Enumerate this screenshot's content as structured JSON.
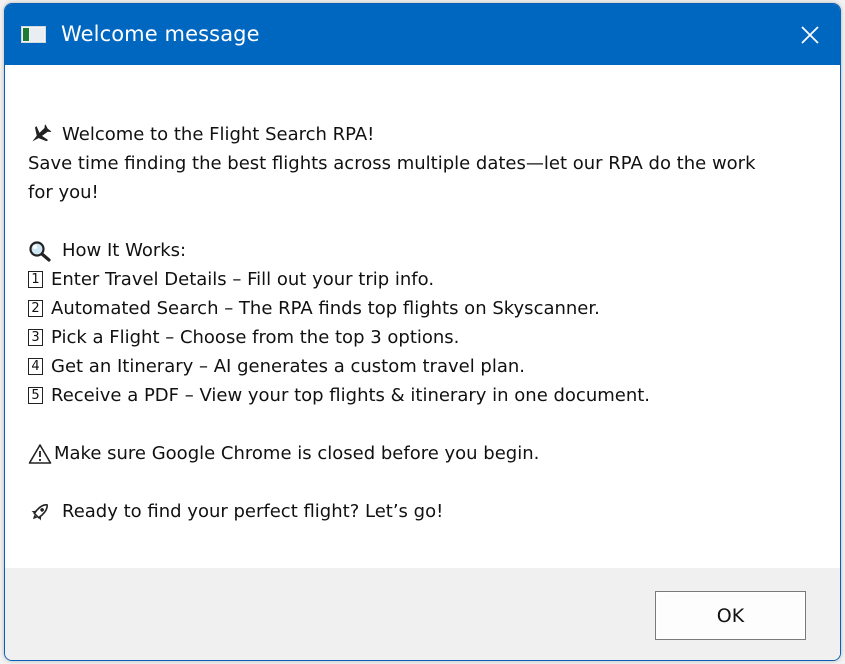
{
  "window": {
    "title": "Welcome message",
    "app_icon": "window-app-icon",
    "close_icon": "close-icon"
  },
  "colors": {
    "titlebar": "#0067c0",
    "title_text": "#ffffff",
    "content_bg": "#ffffff",
    "footer_bg": "#f0f0f0"
  },
  "message": {
    "welcome_icon": "airplane-icon",
    "welcome": "Welcome to the Flight Search RPA!",
    "intro_1": "Save time finding the best flights across multiple dates—let our RPA do the work",
    "intro_2": "for you!",
    "how_icon": "magnifying-glass-icon",
    "how_title": "How It Works:",
    "steps": [
      {
        "num": "1",
        "text": "Enter Travel Details – Fill out your trip info."
      },
      {
        "num": "2",
        "text": "Automated Search – The RPA finds top flights on Skyscanner."
      },
      {
        "num": "3",
        "text": "Pick a Flight – Choose from the top 3 options."
      },
      {
        "num": "4",
        "text": "Get an Itinerary – AI generates a custom travel plan."
      },
      {
        "num": "5",
        "text": "Receive a PDF – View your top flights & itinerary in one document."
      }
    ],
    "warning_icon": "warning-icon",
    "warning": "Make sure Google Chrome is closed before you begin.",
    "rocket_icon": "rocket-icon",
    "closing": "Ready to find your perfect flight? Let’s go!"
  },
  "footer": {
    "ok_label": "OK"
  }
}
